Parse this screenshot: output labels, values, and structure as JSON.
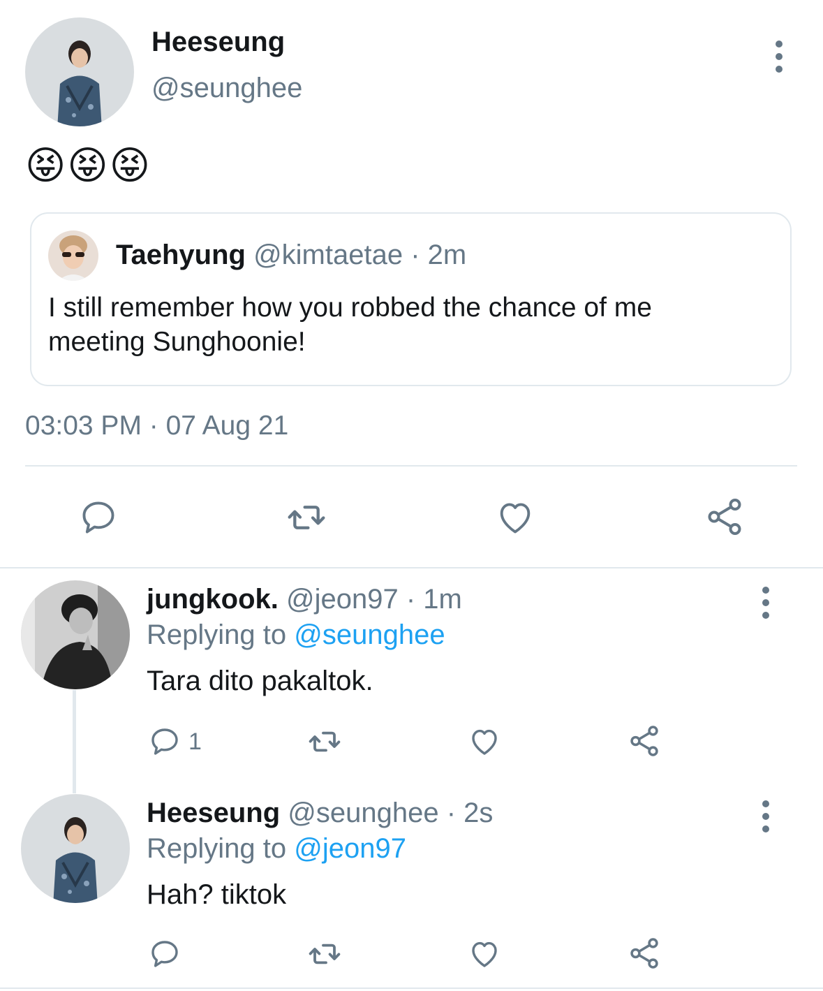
{
  "main_tweet": {
    "author_name": "Heeseung",
    "author_handle": "@seunghee",
    "text": "😝😝😝",
    "quoted": {
      "author_name": "Taehyung",
      "author_handle": "@kimtaetae",
      "time": "· 2m",
      "text": "I still remember how you robbed the chance of me meeting Sunghoonie!"
    },
    "timestamp": "03:03 PM · 07 Aug 21",
    "actions": [
      "reply-icon",
      "retweet-icon",
      "like-icon",
      "share-icon"
    ]
  },
  "replies": [
    {
      "author_name": "jungkook.",
      "author_handle": "@jeon97",
      "time": "· 1m",
      "replying_prefix": "Replying to",
      "replying_to": "@seunghee",
      "text": "Tara dito pakaltok.",
      "reply_count": "1"
    },
    {
      "author_name": "Heeseung",
      "author_handle": "@seunghee",
      "time": "· 2s",
      "replying_prefix": "Replying to",
      "replying_to": "@jeon97",
      "text": "Hah? tiktok",
      "reply_count": ""
    }
  ],
  "colors": {
    "text": "#14171a",
    "muted": "#657786",
    "link": "#1da1f2",
    "border": "#e1e8ed"
  }
}
